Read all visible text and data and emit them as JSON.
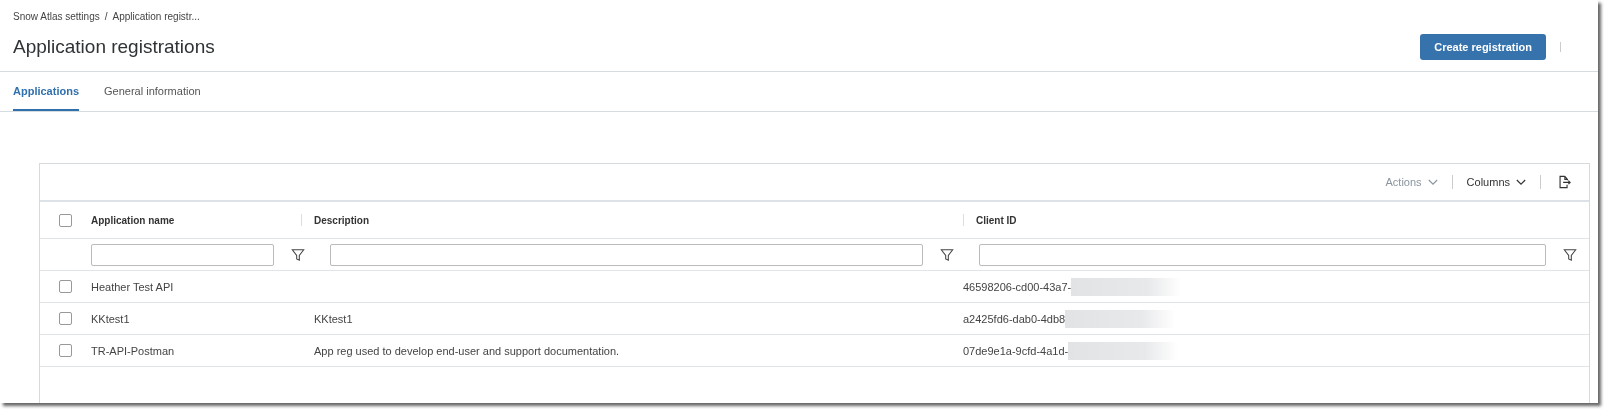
{
  "breadcrumb": [
    "Snow Atlas settings",
    "Application registr..."
  ],
  "breadcrumb_separator": "/",
  "title": "Application registrations",
  "create_button": "Create registration",
  "tabs": [
    {
      "label": "Applications",
      "selected": true
    },
    {
      "label": "General information",
      "selected": false
    }
  ],
  "toolbar": {
    "actions": {
      "label": "Actions",
      "disabled": true
    },
    "columns": {
      "label": "Columns",
      "disabled": false
    }
  },
  "table": {
    "all_checked": false,
    "columns": [
      "Application name",
      "Description",
      "Client ID"
    ],
    "rows": [
      {
        "checked": false,
        "cells": [
          "Heather Test API",
          "",
          "46598206-cd00-43a7-"
        ]
      },
      {
        "checked": false,
        "cells": [
          "KKtest1",
          "KKtest1",
          "a2425fd6-dab0-4db8"
        ]
      },
      {
        "checked": false,
        "cells": [
          "TR-API-Postman",
          "App reg used to develop end-user and support documentation.",
          "07de9e1a-9cfd-4a1d-"
        ]
      }
    ]
  }
}
